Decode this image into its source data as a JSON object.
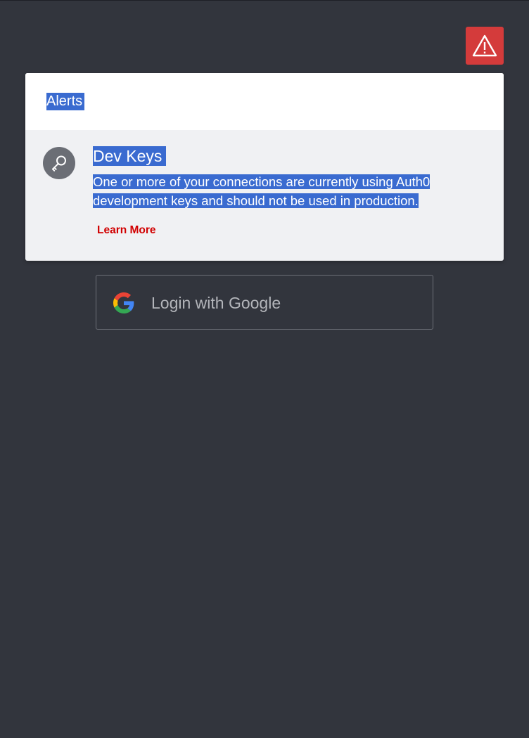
{
  "alert_toggle": {
    "icon": "warning-triangle-icon",
    "color": "#d43b3b"
  },
  "alerts_panel": {
    "title": "Alerts",
    "items": [
      {
        "icon": "key-icon",
        "heading": "Dev Keys",
        "body_lines": [
          "One or more of your connections are currently using Auth0",
          "development keys and should not be used in production."
        ],
        "link_label": "Learn More",
        "link_color": "#d10000"
      }
    ]
  },
  "login": {
    "google_label": "Login with Google",
    "icon": "google-icon"
  },
  "colors": {
    "background": "#32353d",
    "selection": "#3a6bd0"
  }
}
